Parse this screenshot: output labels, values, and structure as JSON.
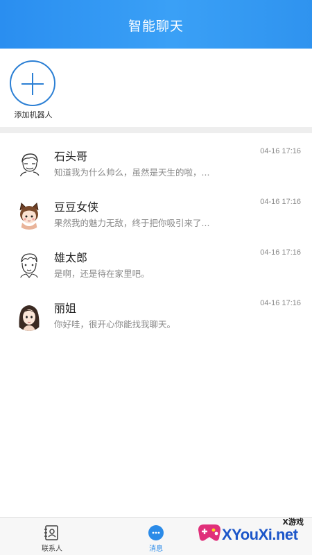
{
  "header": {
    "title": "智能聊天"
  },
  "add_robot": {
    "label": "添加机器人"
  },
  "chats": [
    {
      "name": "石头哥",
      "time": "04-16 17:16",
      "preview": "知道我为什么帅么，虽然是天生的啦，..."
    },
    {
      "name": "豆豆女侠",
      "time": "04-16 17:16",
      "preview": "果然我的魅力无敌，终于把你吸引来了..."
    },
    {
      "name": "雄太郎",
      "time": "04-16 17:16",
      "preview": "是啊，还是待在家里吧。"
    },
    {
      "name": "丽姐",
      "time": "04-16 17:16",
      "preview": "你好哇，很开心你能找我聊天。"
    }
  ],
  "tabbar": {
    "contacts_label": "联系人",
    "messages_label": "消息"
  },
  "watermark": {
    "small_text": "X游戏",
    "big_text": "XYouXi.net"
  },
  "colors": {
    "header": "#3399f3",
    "accent": "#2b8be8",
    "add_circle": "#2b7fd4"
  }
}
